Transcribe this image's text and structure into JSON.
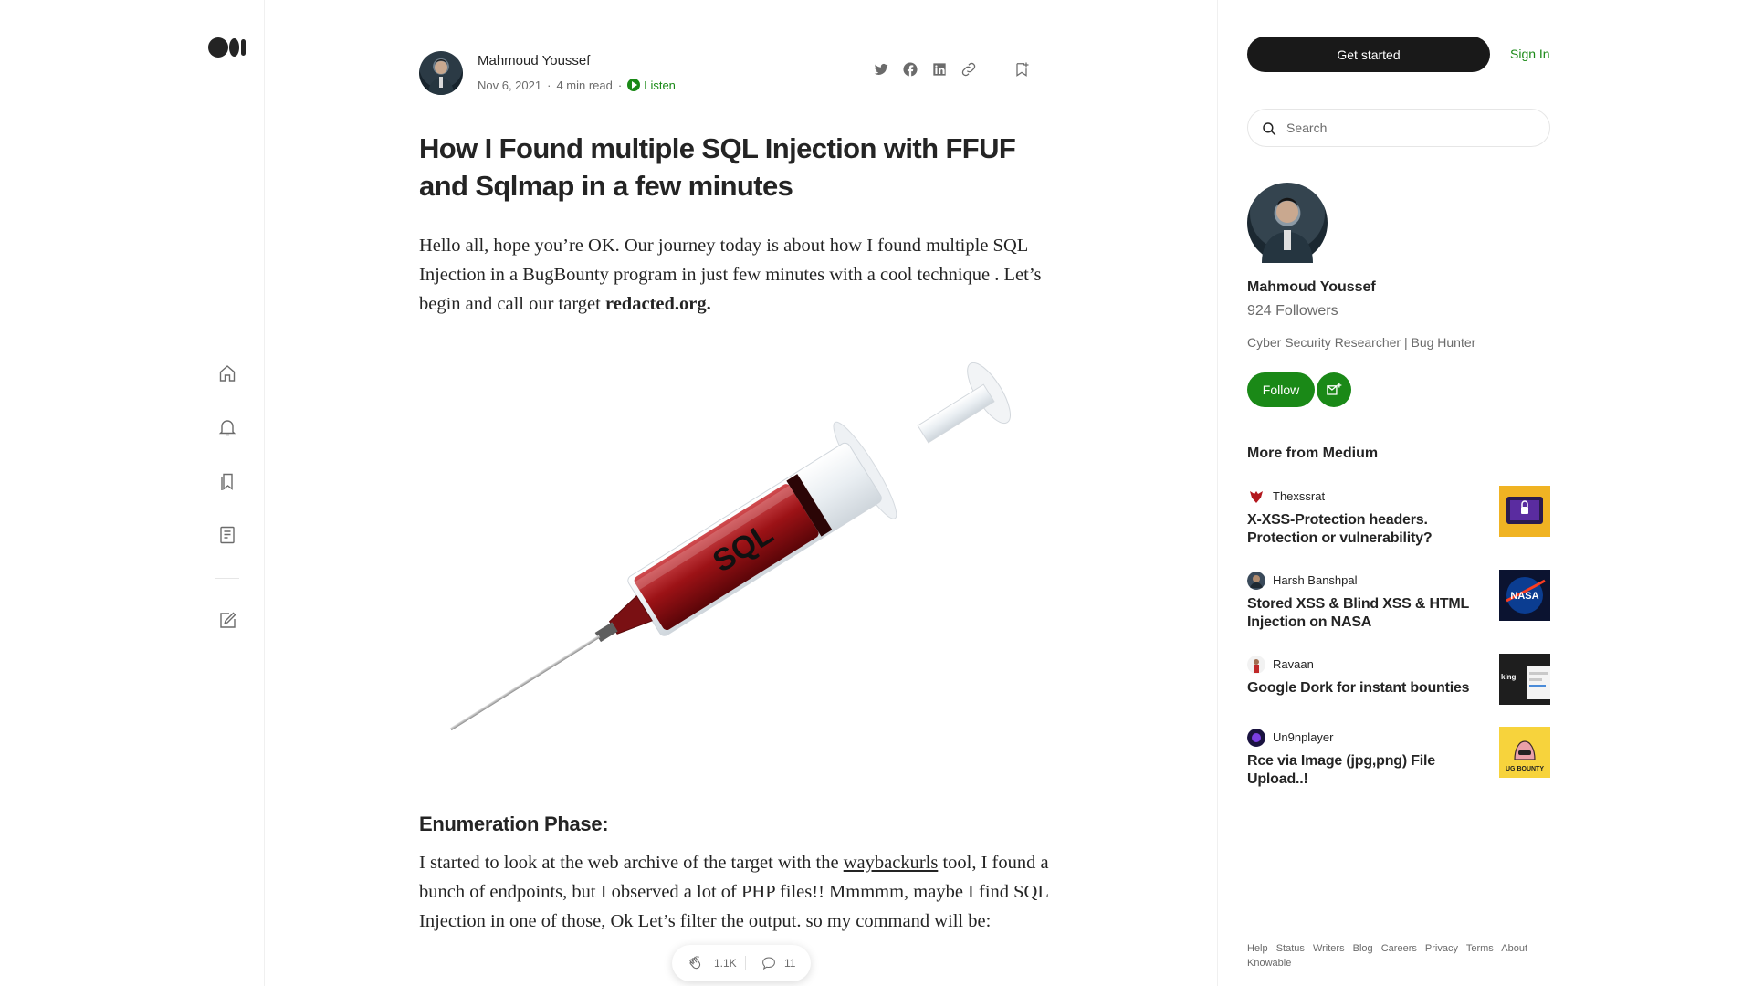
{
  "article": {
    "author": "Mahmoud Youssef",
    "date": "Nov 6, 2021",
    "read_time": "4 min read",
    "listen_label": "Listen",
    "title": "How I Found multiple SQL Injection with FFUF and Sqlmap in a few minutes",
    "intro_text": "Hello all, hope you’re OK. Our journey today is about how I found multiple SQL Injection in a BugBounty program in just few minutes with a cool technique . Let’s begin and call our target ",
    "intro_target": "redacted.org.",
    "image_label": "SQL",
    "section_heading": "Enumeration Phase:",
    "section_text_before": "I started to look at the web archive of the target with the ",
    "section_link": "waybackurls",
    "section_text_after": " tool, I found a bunch of endpoints, but I observed a lot of PHP files!! Mmmmm, maybe I find SQL Injection in one of those, Ok Let’s filter the output. so my command will be:",
    "claps": "1.1K",
    "responses": "11"
  },
  "sidebar": {
    "get_started": "Get started",
    "sign_in": "Sign In",
    "search_placeholder": "Search",
    "author_name": "Mahmoud Youssef",
    "followers": "924 Followers",
    "bio": "Cyber Security Researcher | Bug Hunter",
    "follow": "Follow",
    "more_from": "More from Medium",
    "recommendations": [
      {
        "author": "Thexssrat",
        "title": "X-XSS-Protection headers. Protection or vulnerability?"
      },
      {
        "author": "Harsh Banshpal",
        "title": "Stored XSS & Blind XSS & HTML Injection on NASA"
      },
      {
        "author": "Ravaan",
        "title": "Google Dork for instant bounties"
      },
      {
        "author": "Un9nplayer",
        "title": "Rce via Image (jpg,png) File Upload..!"
      }
    ],
    "thumb_texts": {
      "nasa": "NASA",
      "dork": "king",
      "bug_bounty": "UG BOUNTY"
    },
    "footer_links": [
      "Help",
      "Status",
      "Writers",
      "Blog",
      "Careers",
      "Privacy",
      "Terms",
      "About",
      "Knowable"
    ]
  },
  "colors": {
    "accent_green": "#1a8917",
    "text": "#242424",
    "muted": "#6b6b6b",
    "dark_button": "#191919"
  },
  "icons": {
    "rail": [
      "medium-logo",
      "home-icon",
      "bell-icon",
      "bookmarks-icon",
      "stories-icon",
      "write-icon"
    ],
    "share": [
      "twitter-icon",
      "facebook-icon",
      "linkedin-icon",
      "link-icon",
      "bookmark-add-icon"
    ]
  }
}
